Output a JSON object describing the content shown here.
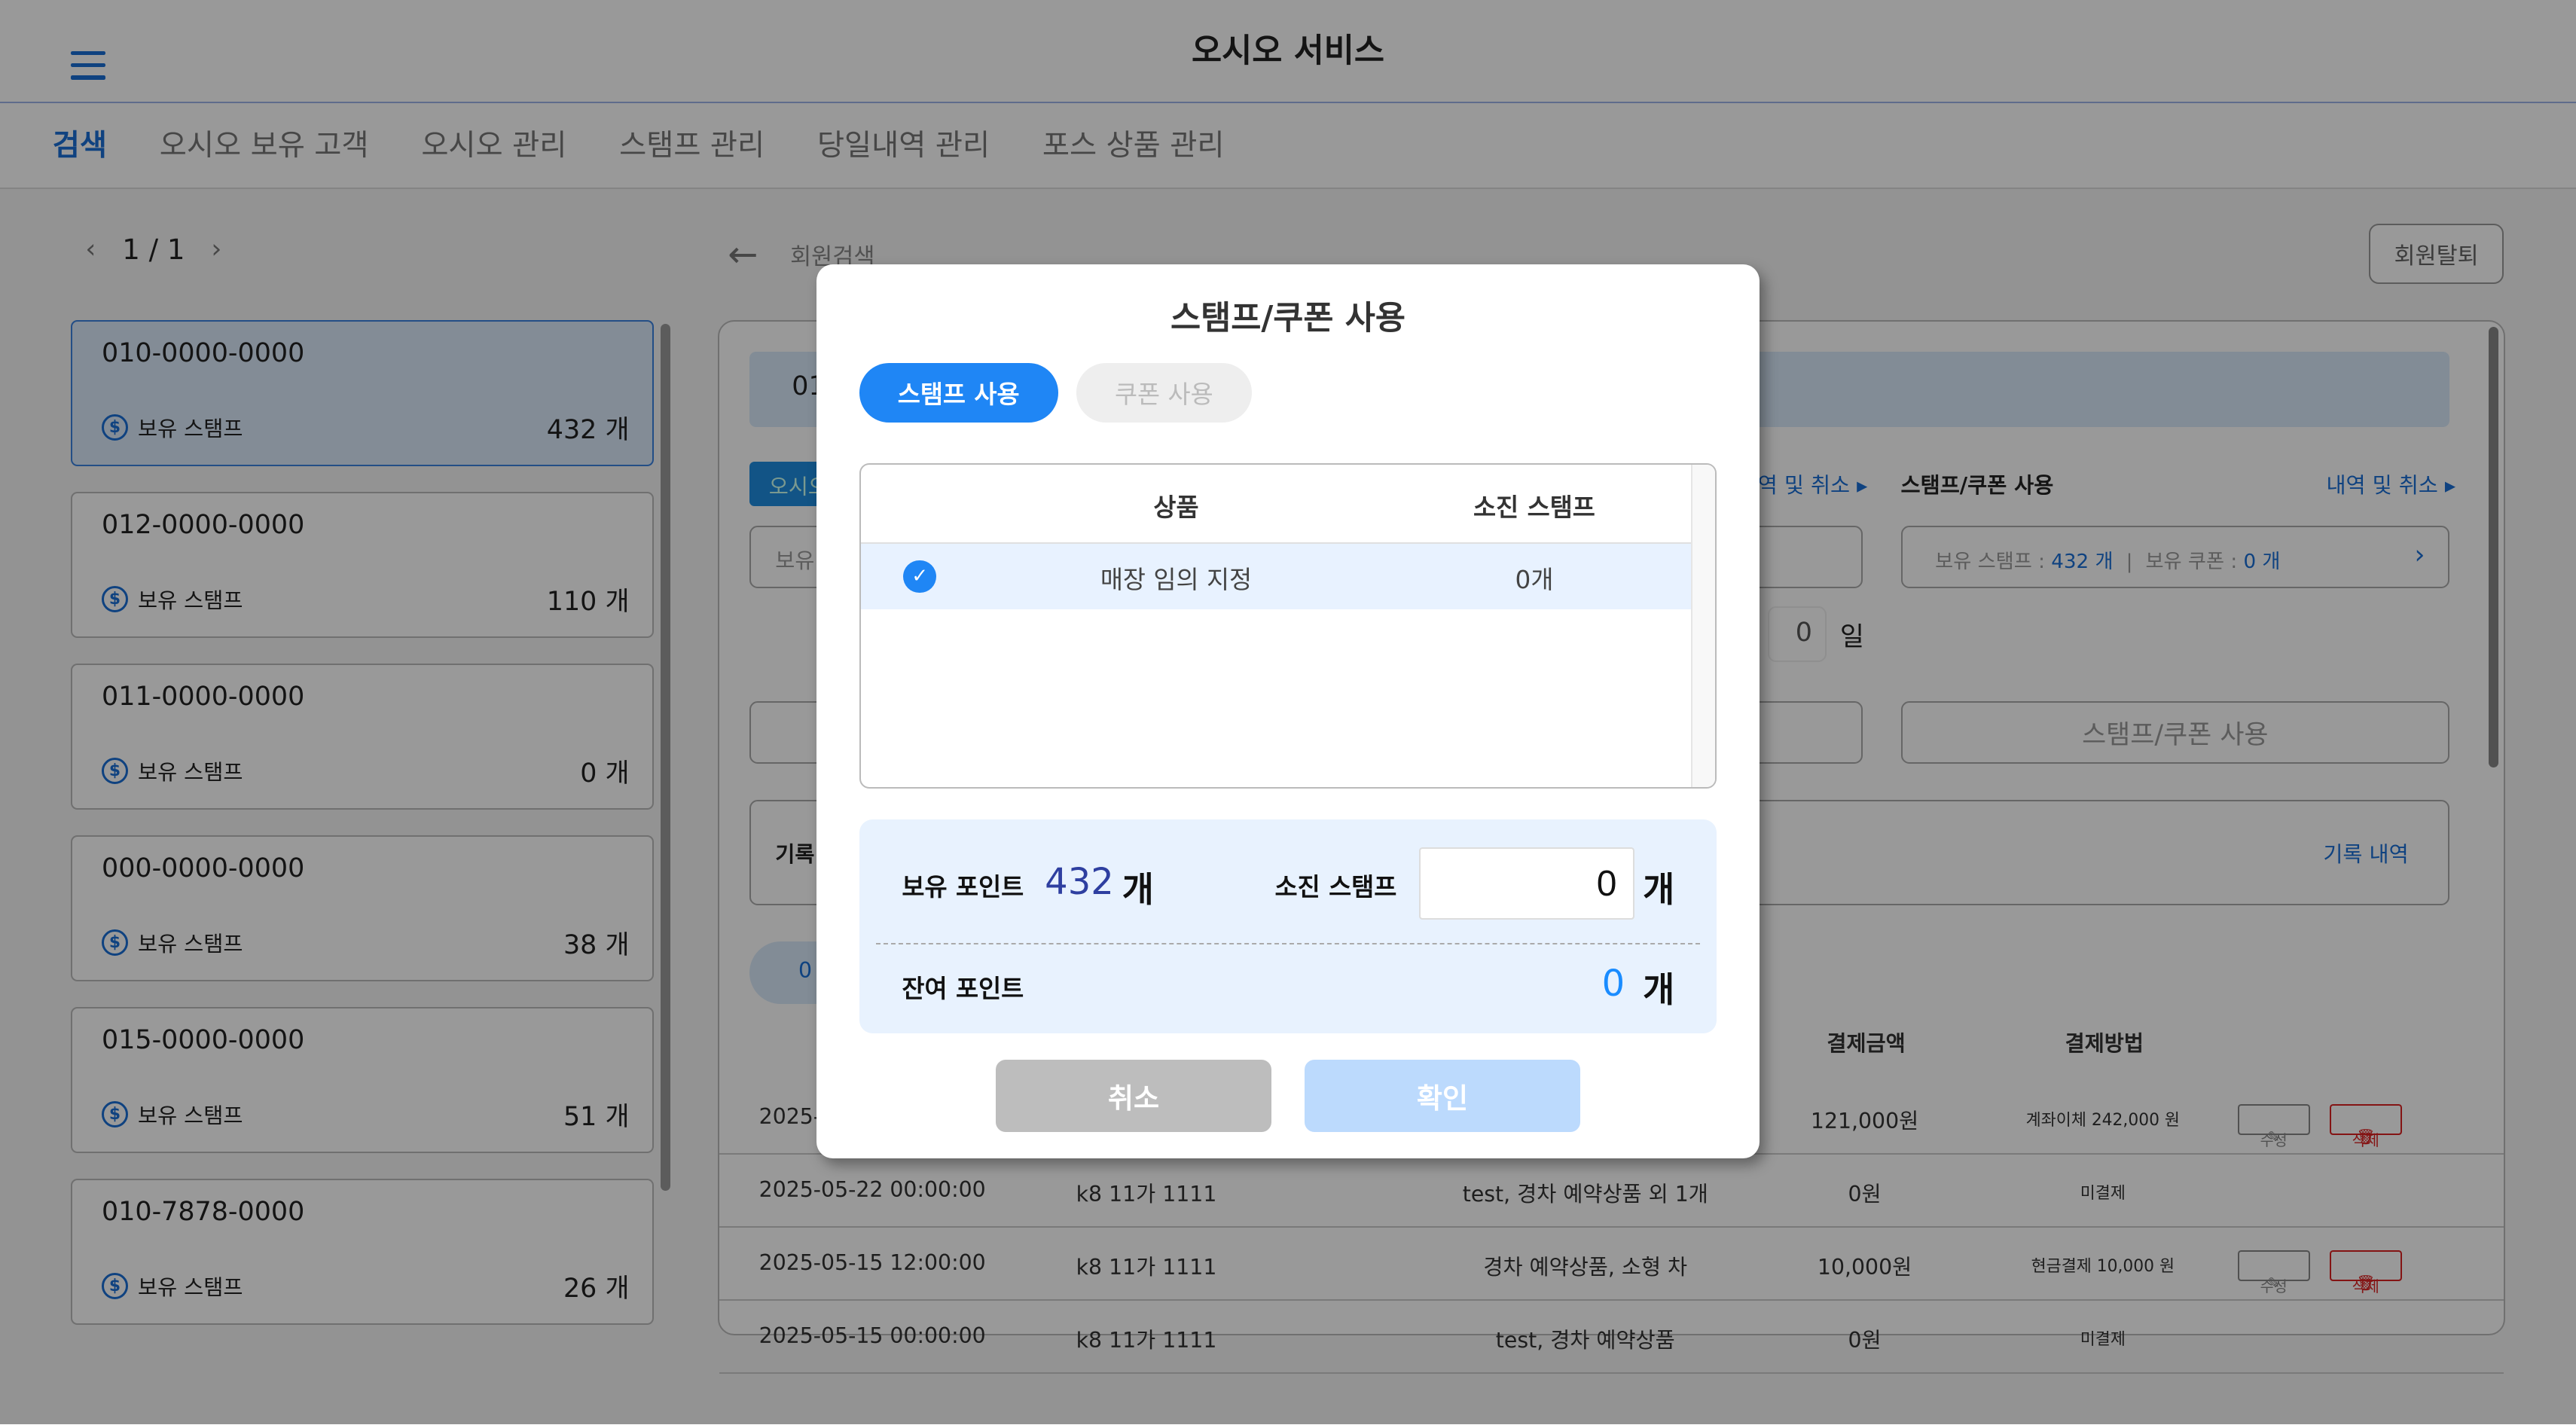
{
  "header": {
    "title": "오시오 서비스",
    "menu_icon": "hamburger-icon"
  },
  "tabs": [
    "검색",
    "오시오 보유 고객",
    "오시오 관리",
    "스탬프 관리",
    "당일내역 관리",
    "포스 상품 관리"
  ],
  "pager": {
    "prev": "‹",
    "label": "1 / 1",
    "next": "›"
  },
  "members": [
    {
      "phone": "010-0000-0000",
      "label": "보유 스탬프",
      "count": "432 개"
    },
    {
      "phone": "012-0000-0000",
      "label": "보유 스탬프",
      "count": "110 개"
    },
    {
      "phone": "011-0000-0000",
      "label": "보유 스탬프",
      "count": "0 개"
    },
    {
      "phone": "000-0000-0000",
      "label": "보유 스탬프",
      "count": "38 개"
    },
    {
      "phone": "015-0000-0000",
      "label": "보유 스탬프",
      "count": "51 개"
    },
    {
      "phone": "010-7878-0000",
      "label": "보유 스탬프",
      "count": "26 개"
    }
  ],
  "detail": {
    "back_label": "회원검색",
    "withdraw": "회원탈퇴",
    "phone_partial": "01",
    "tag_partial": "오시오",
    "history_link_partial": "역 및 취소",
    "stamp_section": "스탬프/쿠폰 사용",
    "history_link": "내역 및 취소",
    "left_box_partial": "보유",
    "stamp_summary": {
      "stamp_label": "보유 스탬프 : ",
      "stamp_value": "432 개",
      "sep": "|",
      "coupon_label": "보유 쿠폰 : ",
      "coupon_value": "0 개"
    },
    "days_value": "0",
    "days_unit": "일",
    "use_button": "스탬프/쿠폰 사용",
    "record_label_partial": "기록",
    "record_link": "기록 내역",
    "pill_partial": "0",
    "table_headers": {
      "amount": "결제금액",
      "method": "결제방법"
    },
    "rows": [
      {
        "date": "2025-",
        "car": "",
        "product": "",
        "amount": "121,000원",
        "method": "계좌이체 242,000 원",
        "edit": "수정",
        "del": "삭제"
      },
      {
        "date": "2025-05-22 00:00:00",
        "car": "k8 11가 1111",
        "product": "test, 경차 예약상품 외 1개",
        "amount": "0원",
        "method": "미결제"
      },
      {
        "date": "2025-05-15 12:00:00",
        "car": "k8 11가 1111",
        "product": "경차 예약상품, 소형 차",
        "amount": "10,000원",
        "method": "현금결제 10,000 원",
        "edit": "수정",
        "del": "삭제"
      },
      {
        "date": "2025-05-15 00:00:00",
        "car": "k8 11가 1111",
        "product": "test, 경차 예약상품",
        "amount": "0원",
        "method": "미결제"
      }
    ]
  },
  "modal": {
    "title": "스탬프/쿠폰 사용",
    "tabs": {
      "stamp": "스탬프 사용",
      "coupon": "쿠폰 사용"
    },
    "table": {
      "col_product": "상품",
      "col_stamp": "소진 스탬프",
      "rows": [
        {
          "product": "매장 임의 지정",
          "stamp": "0개",
          "checked": true
        }
      ]
    },
    "summary": {
      "held_label": "보유 포인트",
      "held_value": "432",
      "unit": "개",
      "use_label": "소진 스탬프",
      "use_value": "0",
      "remain_label": "잔여 포인트",
      "remain_value": "0"
    },
    "cancel": "취소",
    "confirm": "확인"
  },
  "colors": {
    "accent": "#1f86f5",
    "held": "#2e3fa0",
    "remain": "#1a8cff",
    "cancel_bg": "#bdbdbd",
    "confirm_bg": "#bcdafd"
  }
}
